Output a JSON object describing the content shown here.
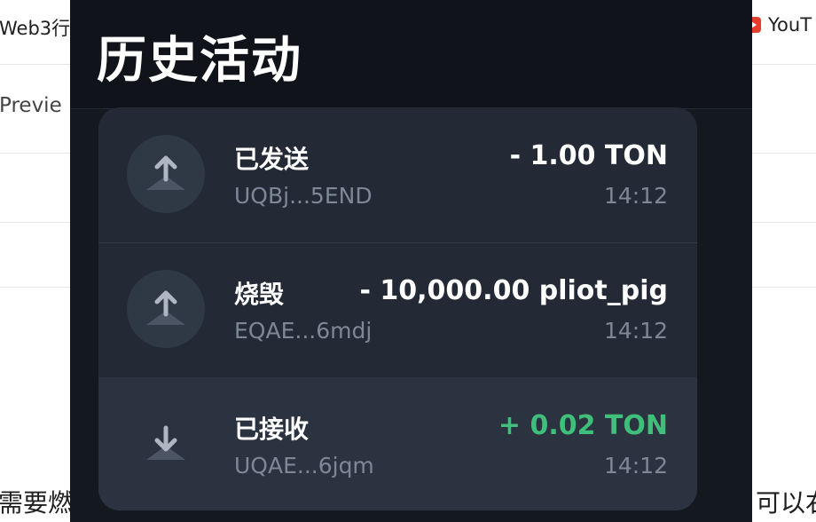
{
  "background": {
    "bookmark_left": "Web3行",
    "bookmark_right": "YouT",
    "preview_tab": "Previe",
    "bottom_left_text": "需要燃",
    "bottom_right_text": "可以右"
  },
  "popup": {
    "title": "历史活动",
    "transactions": [
      {
        "type": "sent",
        "icon": "arrow-up-icon",
        "label": "已发送",
        "address": "UQBj...5END",
        "amount": "- 1.00 TON",
        "time": "14:12"
      },
      {
        "type": "burn",
        "icon": "arrow-up-icon",
        "label": "烧毁",
        "address": "EQAE...6mdj",
        "amount": "- 10,000.00 pliot_pig",
        "time": "14:12"
      },
      {
        "type": "received",
        "icon": "arrow-down-icon",
        "label": "已接收",
        "address": "UQAE...6jqm",
        "amount": "+ 0.02 TON",
        "time": "14:12"
      }
    ]
  },
  "colors": {
    "popup_bg": "#141920",
    "card_bg": "#232a35",
    "positive": "#3fbf7a",
    "muted": "#7d8796"
  }
}
